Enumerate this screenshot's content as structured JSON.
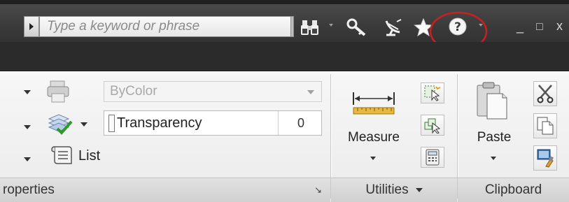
{
  "search": {
    "placeholder": "Type a keyword or phrase"
  },
  "toolbar": {
    "icons": [
      "binoculars-icon",
      "key-icon",
      "satellite-dish-icon",
      "star-icon",
      "help-icon"
    ],
    "help_highlight_color": "#cc1f1f"
  },
  "window": {
    "minimize": "_",
    "restore": "□",
    "close": "x"
  },
  "properties": {
    "color_value": "ByColor",
    "transparency_label": "Transparency",
    "transparency_value": "0",
    "list_label": "List",
    "panel_title": "roperties",
    "launcher_glyph": "↘"
  },
  "utilities": {
    "measure_label": "Measure",
    "panel_title": "Utilities"
  },
  "clipboard": {
    "paste_label": "Paste",
    "panel_title": "Clipboard"
  }
}
